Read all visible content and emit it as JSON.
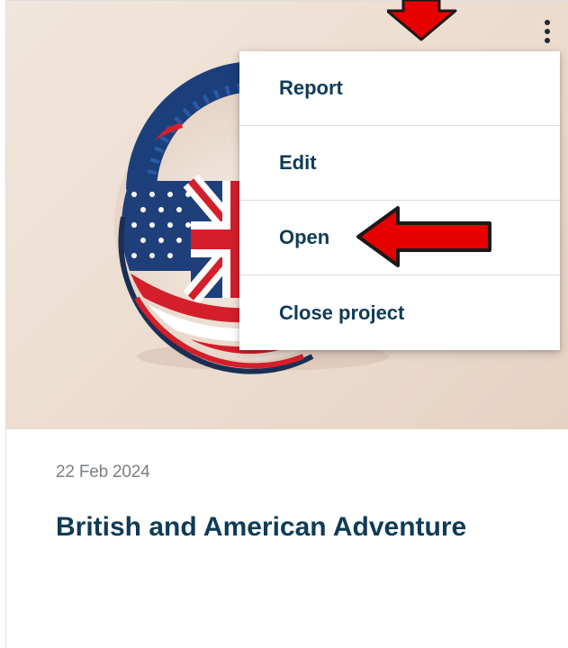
{
  "card": {
    "date": "22 Feb 2024",
    "title": "British and American Adventure",
    "image_icon": "us-uk-flag-globe-icon"
  },
  "menu": {
    "trigger_icon": "kebab-menu-icon",
    "items": [
      {
        "label": "Report"
      },
      {
        "label": "Edit"
      },
      {
        "label": "Open"
      },
      {
        "label": "Close project"
      }
    ]
  },
  "annotations": {
    "down_arrow_icon": "red-arrow-down-icon",
    "left_arrow_icon": "red-arrow-left-icon",
    "arrow_color": "#e60000"
  },
  "colors": {
    "title": "#0f3b57",
    "date": "#7a7f84",
    "hero_bg": "#ecdccf"
  }
}
